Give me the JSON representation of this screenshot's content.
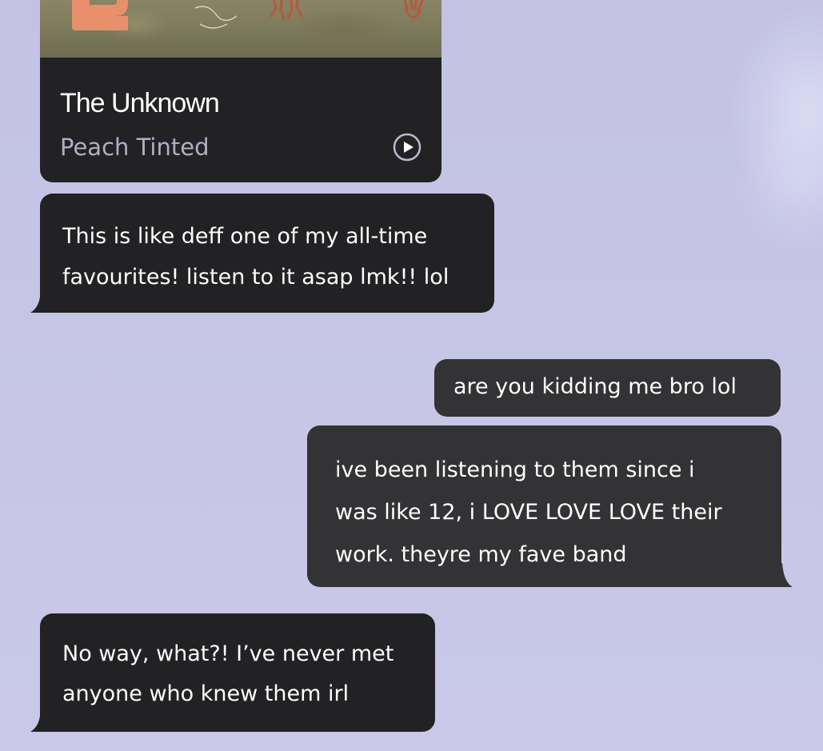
{
  "album_card": {
    "title": "The Unknown",
    "artist": "Peach Tinted",
    "play_icon": "play-circle-icon"
  },
  "messages": [
    {
      "side": "received",
      "text": "This is like deff one of my all-time\nfavourites! listen to it asap lmk!! lol"
    },
    {
      "side": "sent",
      "text": "are you kidding me bro lol"
    },
    {
      "side": "sent",
      "text": "ive been listening to them since i\nwas like 12, i LOVE LOVE LOVE their\nwork. theyre my fave band"
    },
    {
      "side": "received",
      "text": "No way, what?! I’ve never met\nanyone who knew them irl"
    }
  ],
  "colors": {
    "background": "#c5c4e6",
    "received_bubble": "#222224",
    "sent_bubble": "#333335",
    "artist_text": "#b2aec4",
    "album_art_accent": "#e8906c"
  }
}
